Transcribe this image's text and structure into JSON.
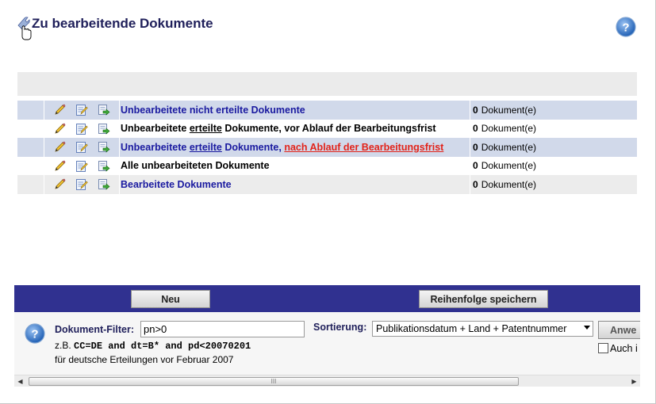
{
  "header": {
    "title": "Zu bearbeitende Dokumente",
    "title_icon": "wrench-hand-cursor-icon",
    "help_icon": "help-icon"
  },
  "rows": [
    {
      "label_parts": [
        {
          "text": "Unbearbeitete nicht erteilte Dokumente",
          "style": "blue"
        }
      ],
      "count": "0",
      "unit": "Dokument(e)"
    },
    {
      "label_parts": [
        {
          "text": "Unbearbeitete ",
          "style": "black"
        },
        {
          "text": "erteilte",
          "style": "black-underline"
        },
        {
          "text": " Dokumente, vor Ablauf der Bearbeitungsfrist",
          "style": "black"
        }
      ],
      "count": "0",
      "unit": "Dokument(e)"
    },
    {
      "label_parts": [
        {
          "text": "Unbearbeitete ",
          "style": "blue"
        },
        {
          "text": "erteilte",
          "style": "blue-underline"
        },
        {
          "text": " Dokumente, ",
          "style": "blue"
        },
        {
          "text": "nach Ablauf der Bearbeitungsfrist",
          "style": "red-underline"
        }
      ],
      "count": "0",
      "unit": "Dokument(e)"
    },
    {
      "label_parts": [
        {
          "text": "Alle unbearbeiteten Dokumente",
          "style": "black"
        }
      ],
      "count": "0",
      "unit": "Dokument(e)"
    },
    {
      "label_parts": [
        {
          "text": "Bearbeitete Dokumente",
          "style": "blue"
        }
      ],
      "count": "0",
      "unit": "Dokument(e)"
    }
  ],
  "row_icons": [
    "pencil-icon",
    "edit-document-icon",
    "export-document-icon"
  ],
  "toolbar": {
    "new_label": "Neu",
    "save_order_label": "Reihenfolge speichern"
  },
  "filter": {
    "label": "Dokument-Filter:",
    "value": "pn>0",
    "example_prefix": "z.B. ",
    "example_code": "CC=DE and dt=B* and pd<20070201",
    "example_note": "für deutsche Erteilungen vor Februar 2007"
  },
  "sort": {
    "label": "Sortierung:",
    "selected": "Publikationsdatum + Land + Patentnummer"
  },
  "apply_label": "Anwe",
  "checkbox_label": "Auch i",
  "scrollbar": {
    "left_arrow": "◀",
    "right_arrow": "▶",
    "grip": "III"
  },
  "colors": {
    "row_highlight": "#d1d9ea",
    "header_bar": "#303190",
    "link_blue": "#1a1aa0",
    "warning_red": "#e2231a"
  }
}
